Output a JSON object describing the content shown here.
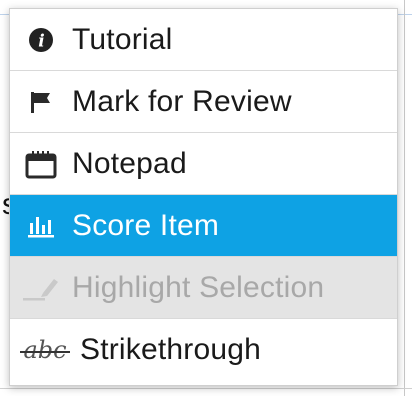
{
  "menu": {
    "items": [
      {
        "label": "Tutorial",
        "icon": "info-circle-icon",
        "state": "normal"
      },
      {
        "label": "Mark for Review",
        "icon": "flag-icon",
        "state": "normal"
      },
      {
        "label": "Notepad",
        "icon": "notepad-icon",
        "state": "normal"
      },
      {
        "label": "Score Item",
        "icon": "bar-chart-icon",
        "state": "selected"
      },
      {
        "label": "Highlight Selection",
        "icon": "highlighter-pen-icon",
        "state": "disabled"
      },
      {
        "label": "Strikethrough",
        "icon": "strikethrough-abc-icon",
        "state": "normal",
        "icon_text": "abc"
      }
    ]
  },
  "colors": {
    "selected_bg": "#0ea2e4",
    "disabled_bg": "#e4e4e4",
    "text": "#1a1a1a",
    "disabled_text": "#a8a8a8"
  }
}
